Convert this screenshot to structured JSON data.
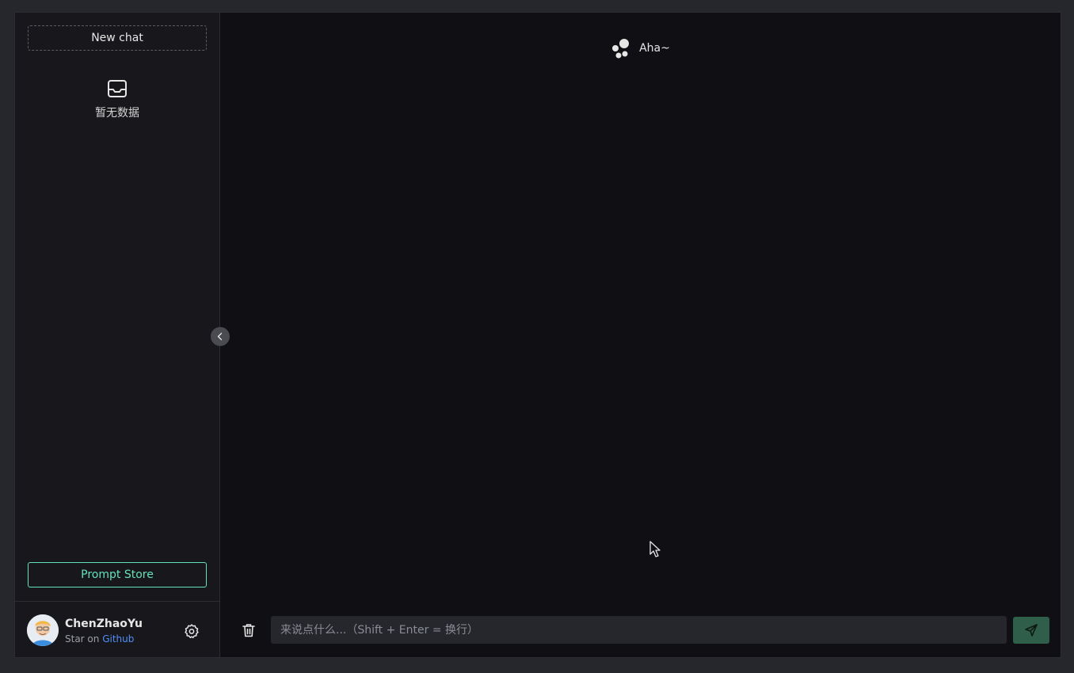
{
  "sidebar": {
    "new_chat_label": "New chat",
    "empty_icon": "inbox-icon",
    "empty_text": "暂无数据",
    "prompt_store_label": "Prompt Store",
    "user": {
      "name": "ChenZhaoYu",
      "sub_prefix": "Star on",
      "sub_link": "Github"
    },
    "settings_icon": "gear-icon",
    "collapse_icon": "chevron-left-icon"
  },
  "main": {
    "header_title": "Aha~",
    "header_icon": "bubbles-icon"
  },
  "input": {
    "placeholder": "来说点什么...（Shift + Enter = 换行）",
    "value": "",
    "clear_icon": "trash-icon",
    "send_icon": "send-icon"
  },
  "colors": {
    "background": "#101014",
    "sidebar": "#18181c",
    "accent": "#63e2b7",
    "link": "#4f8ff7",
    "send_button": "#2f5e4a"
  }
}
